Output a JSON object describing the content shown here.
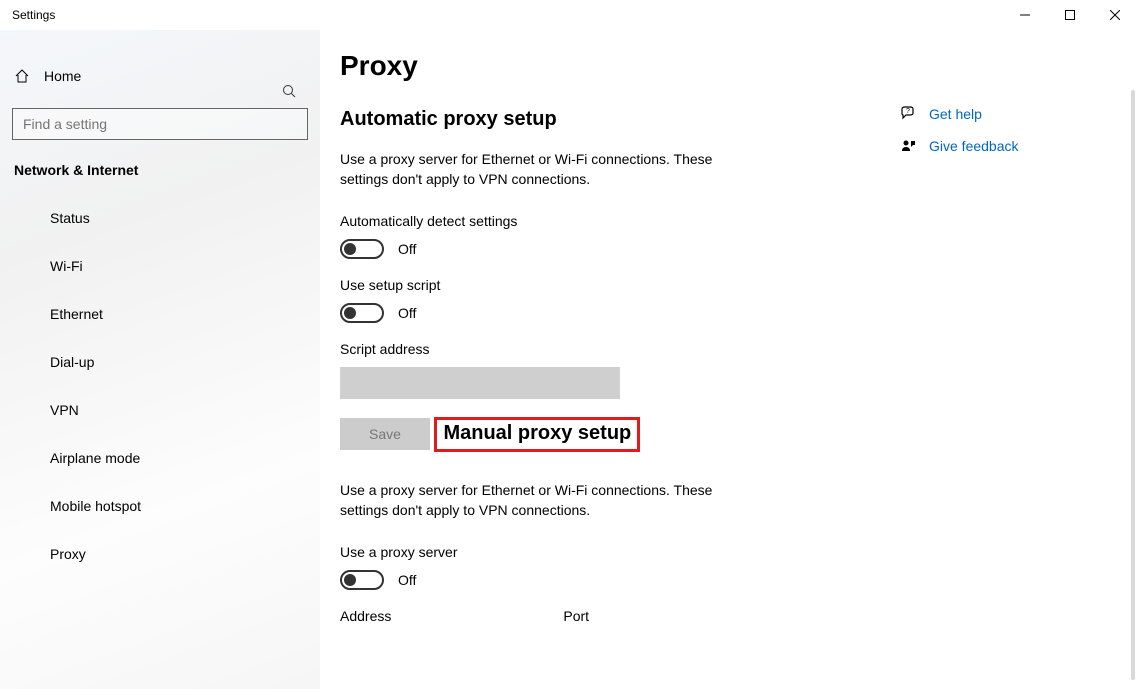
{
  "window": {
    "title": "Settings"
  },
  "sidebar": {
    "home": "Home",
    "search_placeholder": "Find a setting",
    "category": "Network & Internet",
    "items": [
      {
        "icon": "status",
        "label": "Status"
      },
      {
        "icon": "wifi",
        "label": "Wi-Fi"
      },
      {
        "icon": "ethernet",
        "label": "Ethernet"
      },
      {
        "icon": "dialup",
        "label": "Dial-up"
      },
      {
        "icon": "vpn",
        "label": "VPN"
      },
      {
        "icon": "airplane",
        "label": "Airplane mode"
      },
      {
        "icon": "hotspot",
        "label": "Mobile hotspot"
      },
      {
        "icon": "proxy",
        "label": "Proxy"
      }
    ]
  },
  "page": {
    "title": "Proxy",
    "auto": {
      "heading": "Automatic proxy setup",
      "desc": "Use a proxy server for Ethernet or Wi-Fi connections. These settings don't apply to VPN connections.",
      "detect_label": "Automatically detect settings",
      "detect_state": "Off",
      "script_label": "Use setup script",
      "script_state": "Off",
      "script_addr_label": "Script address",
      "script_addr_value": "",
      "save": "Save"
    },
    "manual": {
      "heading": "Manual proxy setup",
      "desc": "Use a proxy server for Ethernet or Wi-Fi connections. These settings don't apply to VPN connections.",
      "use_label": "Use a proxy server",
      "use_state": "Off",
      "address_label": "Address",
      "port_label": "Port"
    }
  },
  "aside": {
    "help": "Get help",
    "feedback": "Give feedback"
  }
}
